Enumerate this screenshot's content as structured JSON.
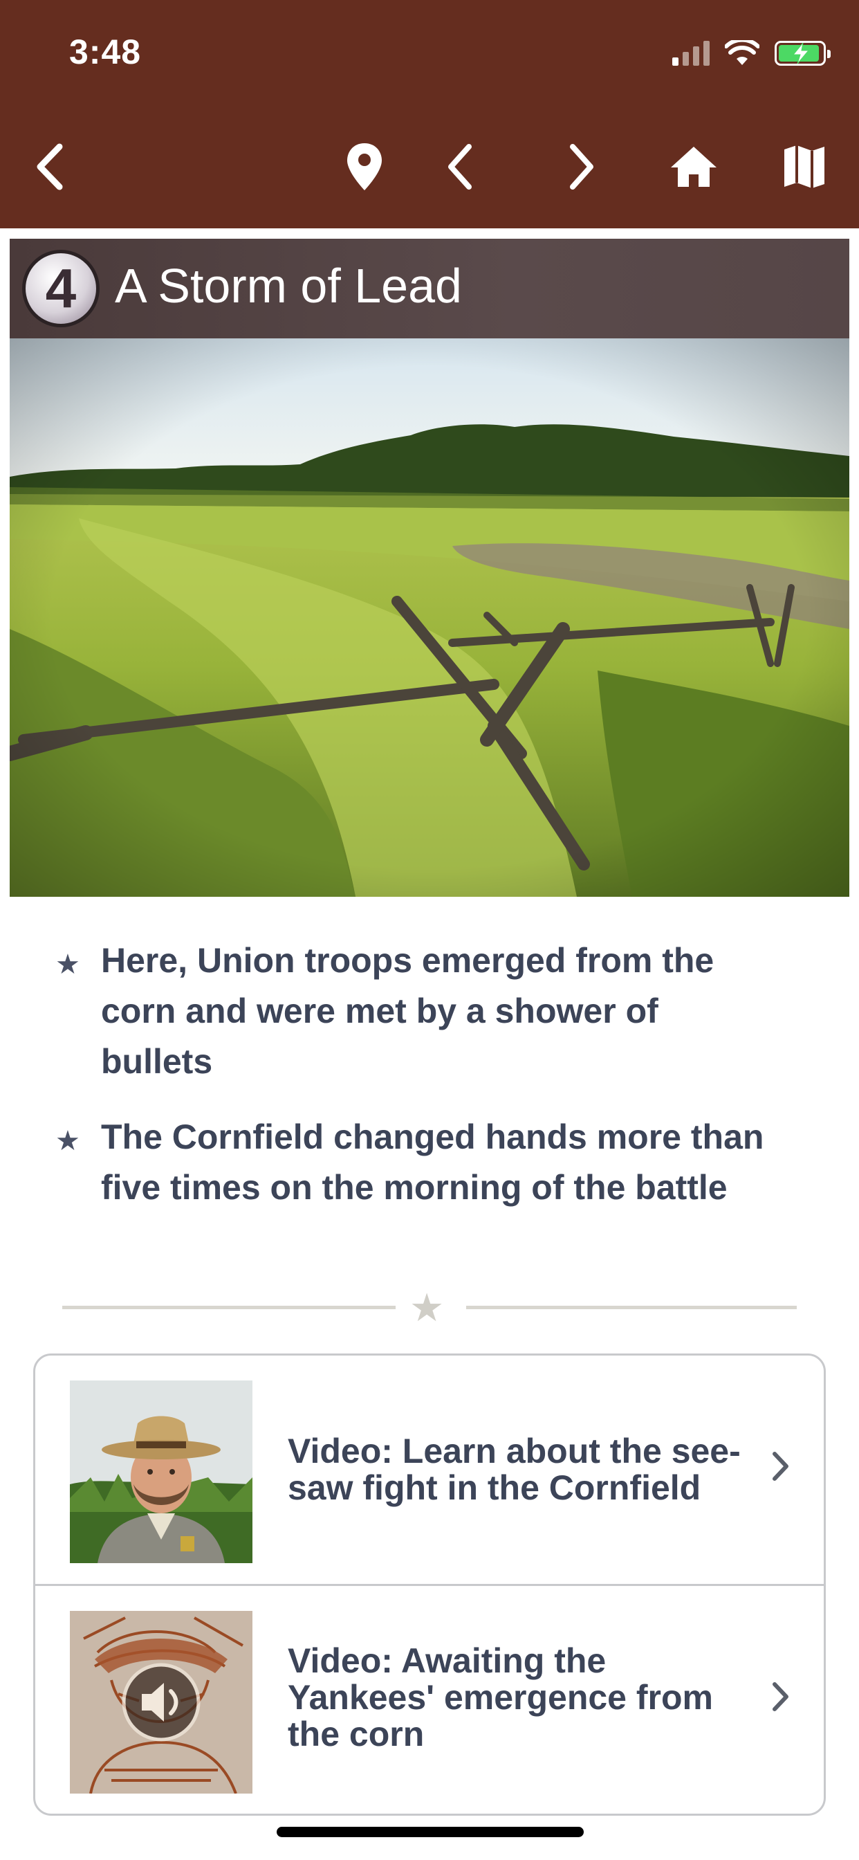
{
  "status_bar": {
    "time": "3:48"
  },
  "nav": {
    "back_icon": "chevron-left-icon",
    "location_icon": "map-pin-icon",
    "prev_icon": "chevron-left-icon",
    "next_icon": "chevron-right-icon",
    "home_icon": "home-icon",
    "map_icon": "map-icon"
  },
  "stop": {
    "number": "4",
    "title": "A Storm of Lead"
  },
  "bullets": [
    "Here, Union troops emerged from the corn and were met by a shower of bullets",
    "The Cornfield changed hands more than five times on the morning of the battle"
  ],
  "media": [
    {
      "label": "Video: Learn about the see-saw fight in the Cornfield",
      "thumb": "ranger-portrait"
    },
    {
      "label": "Video: Awaiting the Yankees' emergence from the corn",
      "thumb": "soldier-sketch-with-audio-icon"
    }
  ],
  "colors": {
    "header_bg": "#652d1f",
    "title_bg": "#4a3a3a",
    "body_text": "#3c4458",
    "battery_green": "#4cd964"
  }
}
